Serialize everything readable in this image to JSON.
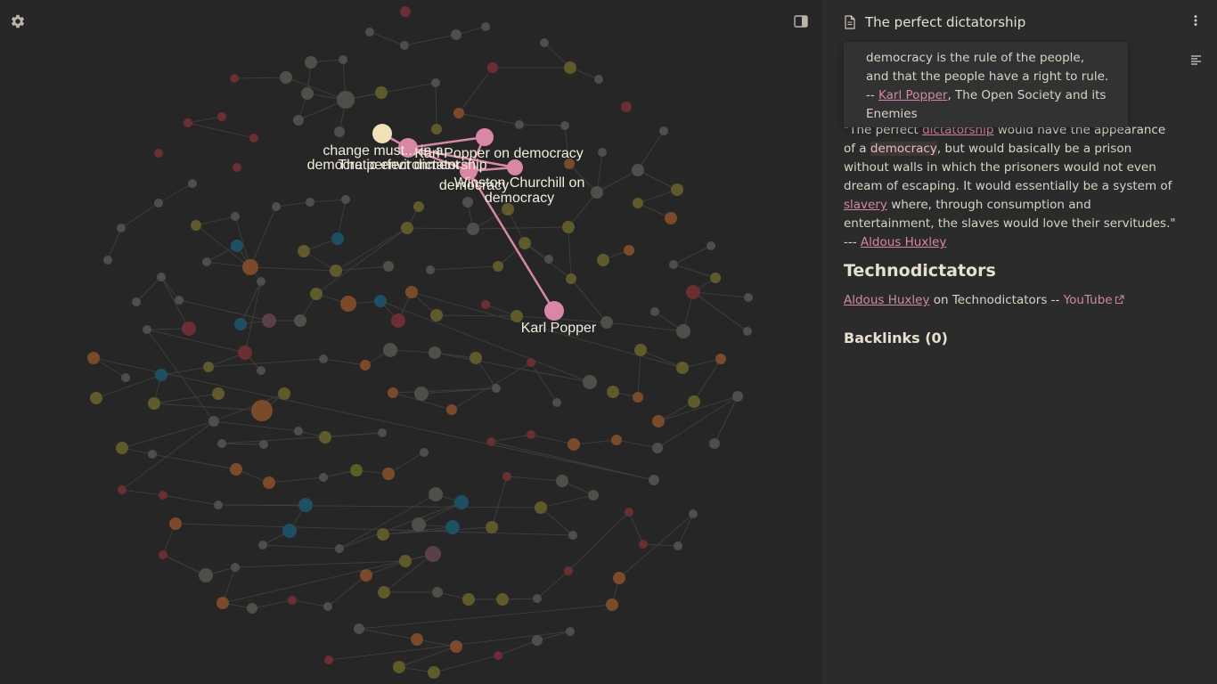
{
  "graph": {
    "colors": {
      "red": "#6b2e33",
      "olive": "#5e5a2c",
      "gray": "#4f4e49",
      "teal": "#1f4f62",
      "orange": "#7a4a2a",
      "mauve": "#5a3f48",
      "edge": "#3d3d3b",
      "active": "#d987a6",
      "current": "#efe2b8"
    },
    "active_labels": [
      "change must... in a democratic environment",
      "The perfect dictatorship",
      "Karl Popper on democracy",
      "democracy",
      "Winston Churchill on democracy",
      "Karl Popper"
    ]
  },
  "note": {
    "title": "The perfect dictatorship",
    "popover": {
      "text_before": "democracy is the rule of the people, and that the people have a right to rule. -- ",
      "link": "Karl Popper",
      "text_after": ", The Open Society and its Enemies"
    },
    "quote": {
      "p1": "\"The perfect ",
      "link_dictatorship": "dictatorship",
      "p2": " would have the appearance of a ",
      "link_democracy": "democracy",
      "p3": ", but would basically be a prison without walls in which the prisoners would not even dream of escaping. It would essentially be a system of ",
      "link_slavery": "slavery",
      "p4": " where, through consumption and entertainment, the slaves would love their servitudes.\" --- ",
      "link_huxley": "Aldous Huxley"
    },
    "section_heading": "Technodictators",
    "techno": {
      "link_huxley": "Aldous Huxley",
      "text": " on Technodictators -- ",
      "link_youtube": "YouTube"
    },
    "backlinks_heading": "Backlinks (0)"
  }
}
